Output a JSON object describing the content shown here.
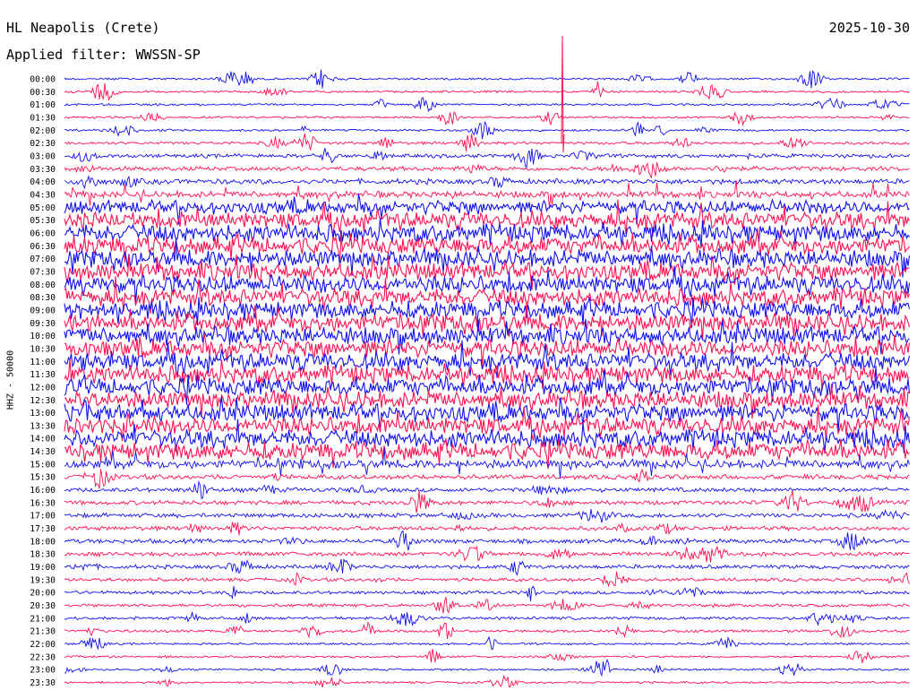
{
  "header": {
    "station": "HL Neapolis (Crete)",
    "filter": "Applied filter: WWSSN-SP",
    "date": "2025-10-30"
  },
  "chart_data": {
    "type": "line",
    "title": "HL Neapolis (Crete)",
    "subtitle": "Applied filter: WWSSN-SP",
    "date": "2025-10-30",
    "ylabel": "HHZ - 50000",
    "rows": [
      "00:00",
      "00:30",
      "01:00",
      "01:30",
      "02:00",
      "02:30",
      "03:00",
      "03:30",
      "04:00",
      "04:30",
      "05:00",
      "05:30",
      "06:00",
      "06:30",
      "07:00",
      "07:30",
      "08:00",
      "08:30",
      "09:00",
      "09:30",
      "10:00",
      "10:30",
      "11:00",
      "11:30",
      "12:00",
      "12:30",
      "13:00",
      "13:30",
      "14:00",
      "14:30",
      "15:00",
      "15:30",
      "16:00",
      "16:30",
      "17:00",
      "17:30",
      "18:00",
      "18:30",
      "19:00",
      "19:30",
      "20:00",
      "20:30",
      "21:00",
      "21:30",
      "22:00",
      "22:30",
      "23:00",
      "23:30"
    ],
    "row_labels": [
      "00:00",
      "00:30",
      "01:00",
      "01:30",
      "02:00",
      "02:30",
      "03:00",
      "03:30",
      "04:00",
      "04:30",
      "05:00",
      "05:30",
      "06:00",
      "06:30",
      "07:00",
      "07:30",
      "08:00",
      "08:30",
      "09:00",
      "09:30",
      "10:00",
      "10:30",
      "11:00",
      "11:30",
      "12:00",
      "12:30",
      "13:00",
      "13:30",
      "14:00",
      "14:30",
      "15:00",
      "15:30",
      "16:00",
      "16:30",
      "17:00",
      "17:30",
      "18:00",
      "18:30",
      "19:00",
      "19:30",
      "20:00",
      "20:30",
      "21:00",
      "21:30",
      "22:00",
      "22:30",
      "23:00",
      "23:30"
    ],
    "colors": [
      "#1010ee",
      "#ff1050"
    ],
    "noise_level": [
      1,
      1,
      1,
      1,
      1,
      1.3,
      1.8,
      2,
      2.4,
      3,
      6,
      7.5,
      8,
      8,
      8,
      8,
      8,
      8,
      8,
      8,
      8,
      8,
      8,
      8,
      8,
      8,
      8,
      8,
      8,
      8,
      4,
      2.2,
      2,
      2,
      2,
      2,
      2,
      2,
      1.8,
      1.6,
      1.5,
      1.5,
      1.4,
      1.2,
      1,
      1,
      1,
      1
    ]
  }
}
